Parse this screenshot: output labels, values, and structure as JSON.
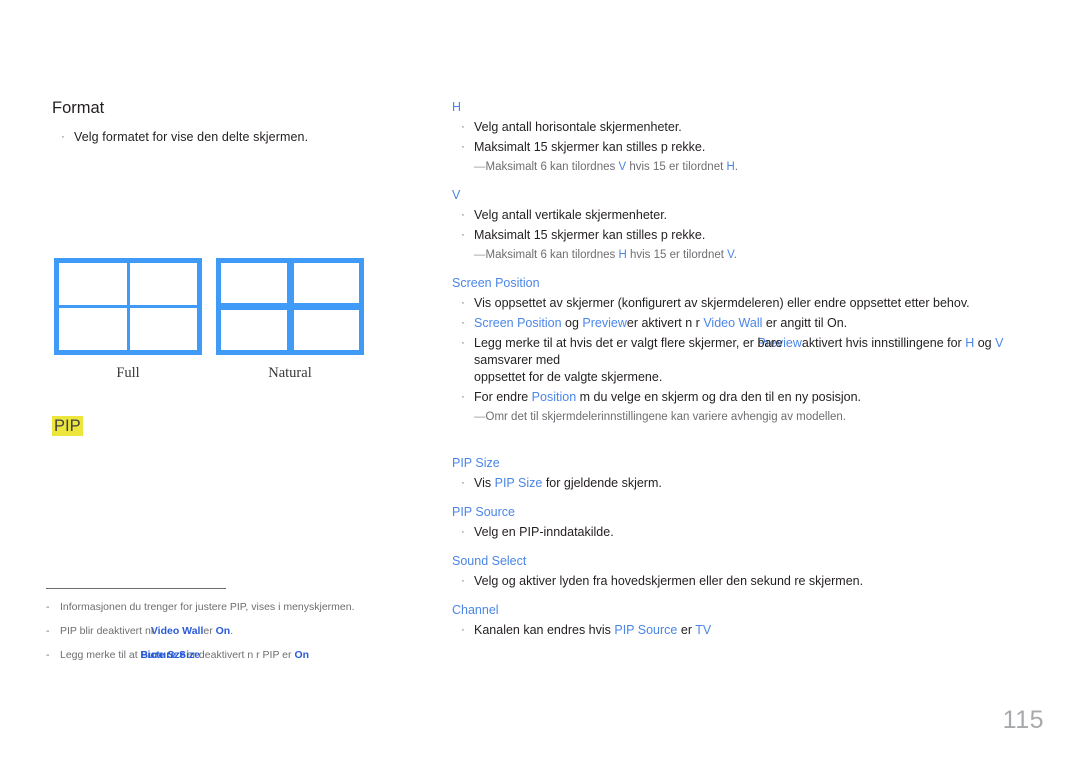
{
  "page": {
    "number": "115"
  },
  "left": {
    "format": {
      "title": "Format",
      "bullets": [
        "Velg formatet for  vise den delte skjermen."
      ]
    },
    "diagrams": [
      {
        "name": "full-grid",
        "label": "Full",
        "rows": 2,
        "cols": 2,
        "gap": 3
      },
      {
        "name": "natural-grid",
        "label": "Natural",
        "rows": 2,
        "cols": 2,
        "gap": 7
      }
    ],
    "pip_heading": "PIP",
    "footnotes": [
      {
        "dash": "-",
        "parts": [
          {
            "text": "Informasjonen du trenger for  justere PIP, vises i menyskjermen.",
            "color": "gray"
          }
        ]
      },
      {
        "dash": "-",
        "overlap": true,
        "pre": "PIP blir deaktivert n",
        "over_a": "Video Wall",
        "over_b": "r ",
        "mid": " er ",
        "tail_a": "On",
        "tail_b": "",
        "post": "."
      },
      {
        "dash": "-",
        "overlap": true,
        "pre": "Legg merke til at ",
        "over_a": "Picture Size",
        "over_b": "Bure Sze",
        "mid": " er deaktivert n r PIP er ",
        "tail_a": "On",
        "tail_b": "",
        "post": ""
      }
    ]
  },
  "right": {
    "blocks": [
      {
        "name": "h",
        "heading": "H",
        "bullets": [
          "Velg antall horisontale skjermenheter.",
          "Maksimalt 15 skjermer kan stilles p  rekke."
        ],
        "note": {
          "pre": "Maksimalt 6 kan tilordnes ",
          "link1": "V",
          "mid": " hvis 15 er tilordnet ",
          "link2": "H",
          "post": "."
        }
      },
      {
        "name": "v",
        "heading": "V",
        "bullets": [
          "Velg antall vertikale skjermenheter.",
          "Maksimalt 15 skjermer kan stilles p  rekke."
        ],
        "note": {
          "pre": "Maksimalt 6 kan tilordnes ",
          "link1": "H",
          "mid": " hvis 15 er tilordnet ",
          "link2": "V",
          "post": "."
        }
      }
    ],
    "screen_position": {
      "heading": "Screen Position",
      "bullet1": "Vis oppsettet av skjermer (konfigurert av skjermdeleren) eller endre oppsettet etter behov.",
      "bullet2": {
        "link1": "Screen Position",
        "t1": " og ",
        "link2": "Preview",
        "t2": "er aktivert n r ",
        "link3": "Video Wall",
        "t3": " er angitt til On."
      },
      "bullet3": {
        "pre": "Legg merke til at hvis det er valgt flere skjermer, er ",
        "over_a": "Preview",
        "over_b": "bare",
        "mid": "aktivert hvis innstillingene for ",
        "link_h": "H",
        "mid2": " og ",
        "link_v": "V",
        "post": " samsvarer med",
        "line2": "oppsettet for de valgte skjermene."
      },
      "bullet4": {
        "pre": "For  endre ",
        "link": "Position",
        "post": " m  du velge en skjerm og dra den til en ny posisjon."
      },
      "note": "Omr det til skjermdelerinnstillingene kan variere avhengig av modellen."
    },
    "lower_blocks": [
      {
        "name": "pip-size",
        "heading": "PIP Size",
        "bullet": {
          "pre": "Vis ",
          "link": "PIP Size",
          "post": " for gjeldende skjerm."
        }
      },
      {
        "name": "pip-source",
        "heading": "PIP Source",
        "bullet": {
          "pre": "Velg en PIP-inndatakilde.",
          "link": "",
          "post": ""
        }
      },
      {
        "name": "sound-select",
        "heading": "Sound Select",
        "bullet": {
          "pre": "Velg og aktiver lyden fra hovedskjermen eller den sekund re skjermen.",
          "link": "",
          "post": ""
        }
      },
      {
        "name": "channel",
        "heading": "Channel",
        "bullet": {
          "pre": "Kanalen kan endres hvis ",
          "link": "PIP Source",
          "post": " er ",
          "link2": "TV"
        }
      }
    ]
  },
  "colors": {
    "accent_blue": "#4a86e8",
    "diagram_blue": "#3f9bf7",
    "highlight_yellow": "#ebe53c",
    "body_text": "#231f20",
    "note_gray": "#6d6e71",
    "page_number_gray": "#a7a9ac"
  }
}
